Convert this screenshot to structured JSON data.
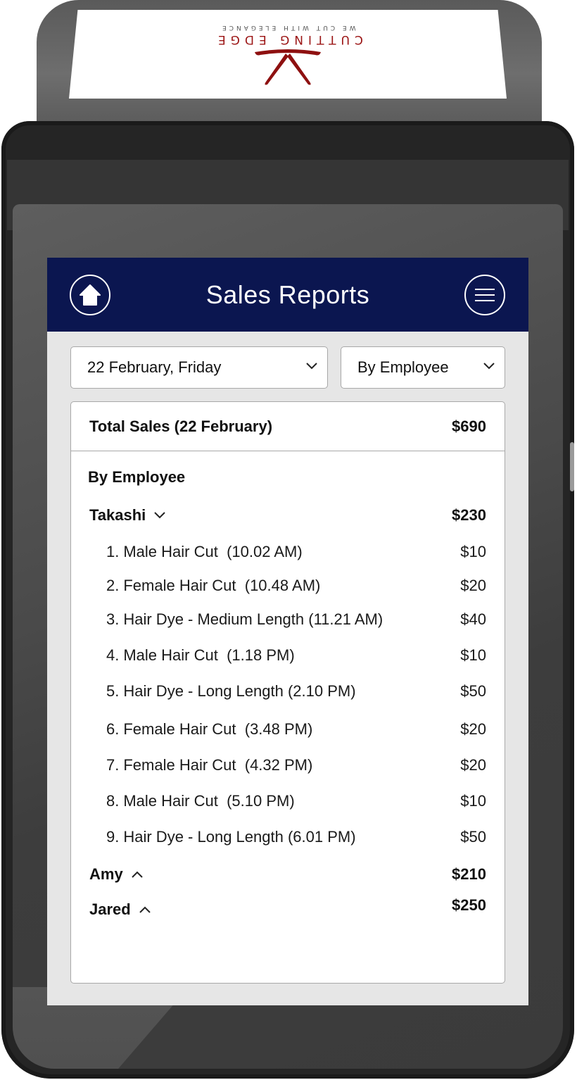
{
  "receipt": {
    "brand": "CUTTING EDGE",
    "tagline": "WE CUT WITH ELEGANCE",
    "brand_color": "#9b1414"
  },
  "header": {
    "title": "Sales Reports",
    "home_icon": "home-icon",
    "menu_icon": "hamburger-menu-icon",
    "background": "#0b1650"
  },
  "filters": {
    "date": {
      "value": "22 February, Friday",
      "icon": "chevron-down-icon"
    },
    "group_by": {
      "value": "By Employee",
      "icon": "chevron-down-icon"
    }
  },
  "report": {
    "total_label": "Total Sales (22 February)",
    "total_value": "$690",
    "section_title": "By Employee",
    "employees": [
      {
        "name": "Takashi",
        "total": "$230",
        "expanded": true,
        "toggle_icon": "chevron-down-icon",
        "items": [
          {
            "index": "1.",
            "label": "Male Hair Cut  (10.02 AM)",
            "amount": "$10"
          },
          {
            "index": "2.",
            "label": "Female Hair Cut  (10.48 AM)",
            "amount": "$20"
          },
          {
            "index": "3.",
            "label": "Hair Dye - Medium Length (11.21 AM)",
            "amount": "$40"
          },
          {
            "index": "4.",
            "label": "Male Hair Cut  (1.18 PM)",
            "amount": "$10"
          },
          {
            "index": "5.",
            "label": "Hair Dye - Long Length (2.10 PM)",
            "amount": "$50"
          },
          {
            "index": "6.",
            "label": "Female Hair Cut  (3.48 PM)",
            "amount": "$20"
          },
          {
            "index": "7.",
            "label": "Female Hair Cut  (4.32 PM)",
            "amount": "$20"
          },
          {
            "index": "8.",
            "label": "Male Hair Cut  (5.10 PM)",
            "amount": "$10"
          },
          {
            "index": "9.",
            "label": "Hair Dye - Long Length (6.01 PM)",
            "amount": "$50"
          }
        ]
      },
      {
        "name": "Amy",
        "total": "$210",
        "expanded": false,
        "toggle_icon": "chevron-up-icon",
        "items": []
      },
      {
        "name": "Jared",
        "total": "$250",
        "expanded": false,
        "toggle_icon": "chevron-up-icon",
        "items": []
      }
    ]
  }
}
